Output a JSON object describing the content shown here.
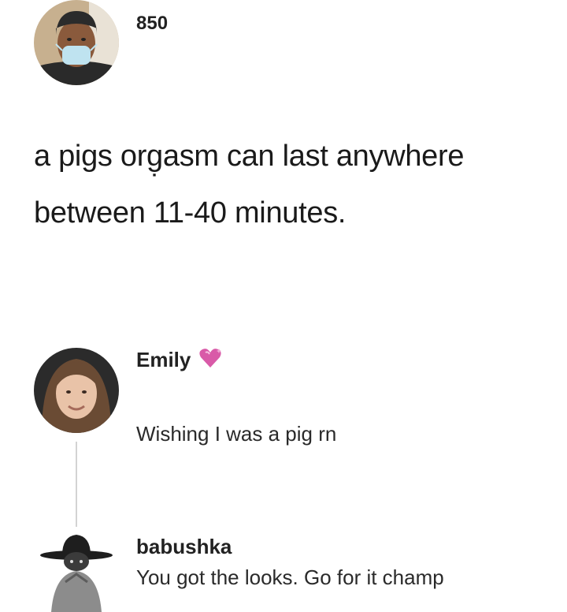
{
  "post": {
    "author": {
      "username": "850",
      "avatar_icon": "masked-person-avatar-icon"
    },
    "body": "a pigs org̣asm can last anywhere between 11-40 minutes."
  },
  "comments": [
    {
      "username": "Emily",
      "badge_icon": "sparkling-heart-icon",
      "badge_color": "#d95aa8",
      "text": "Wishing I was a pig rn",
      "avatar_icon": "woman-portrait-avatar-icon"
    },
    {
      "username": "babushka",
      "text": "You got the looks. Go for it champ",
      "avatar_icon": "hat-figure-avatar-icon"
    }
  ]
}
